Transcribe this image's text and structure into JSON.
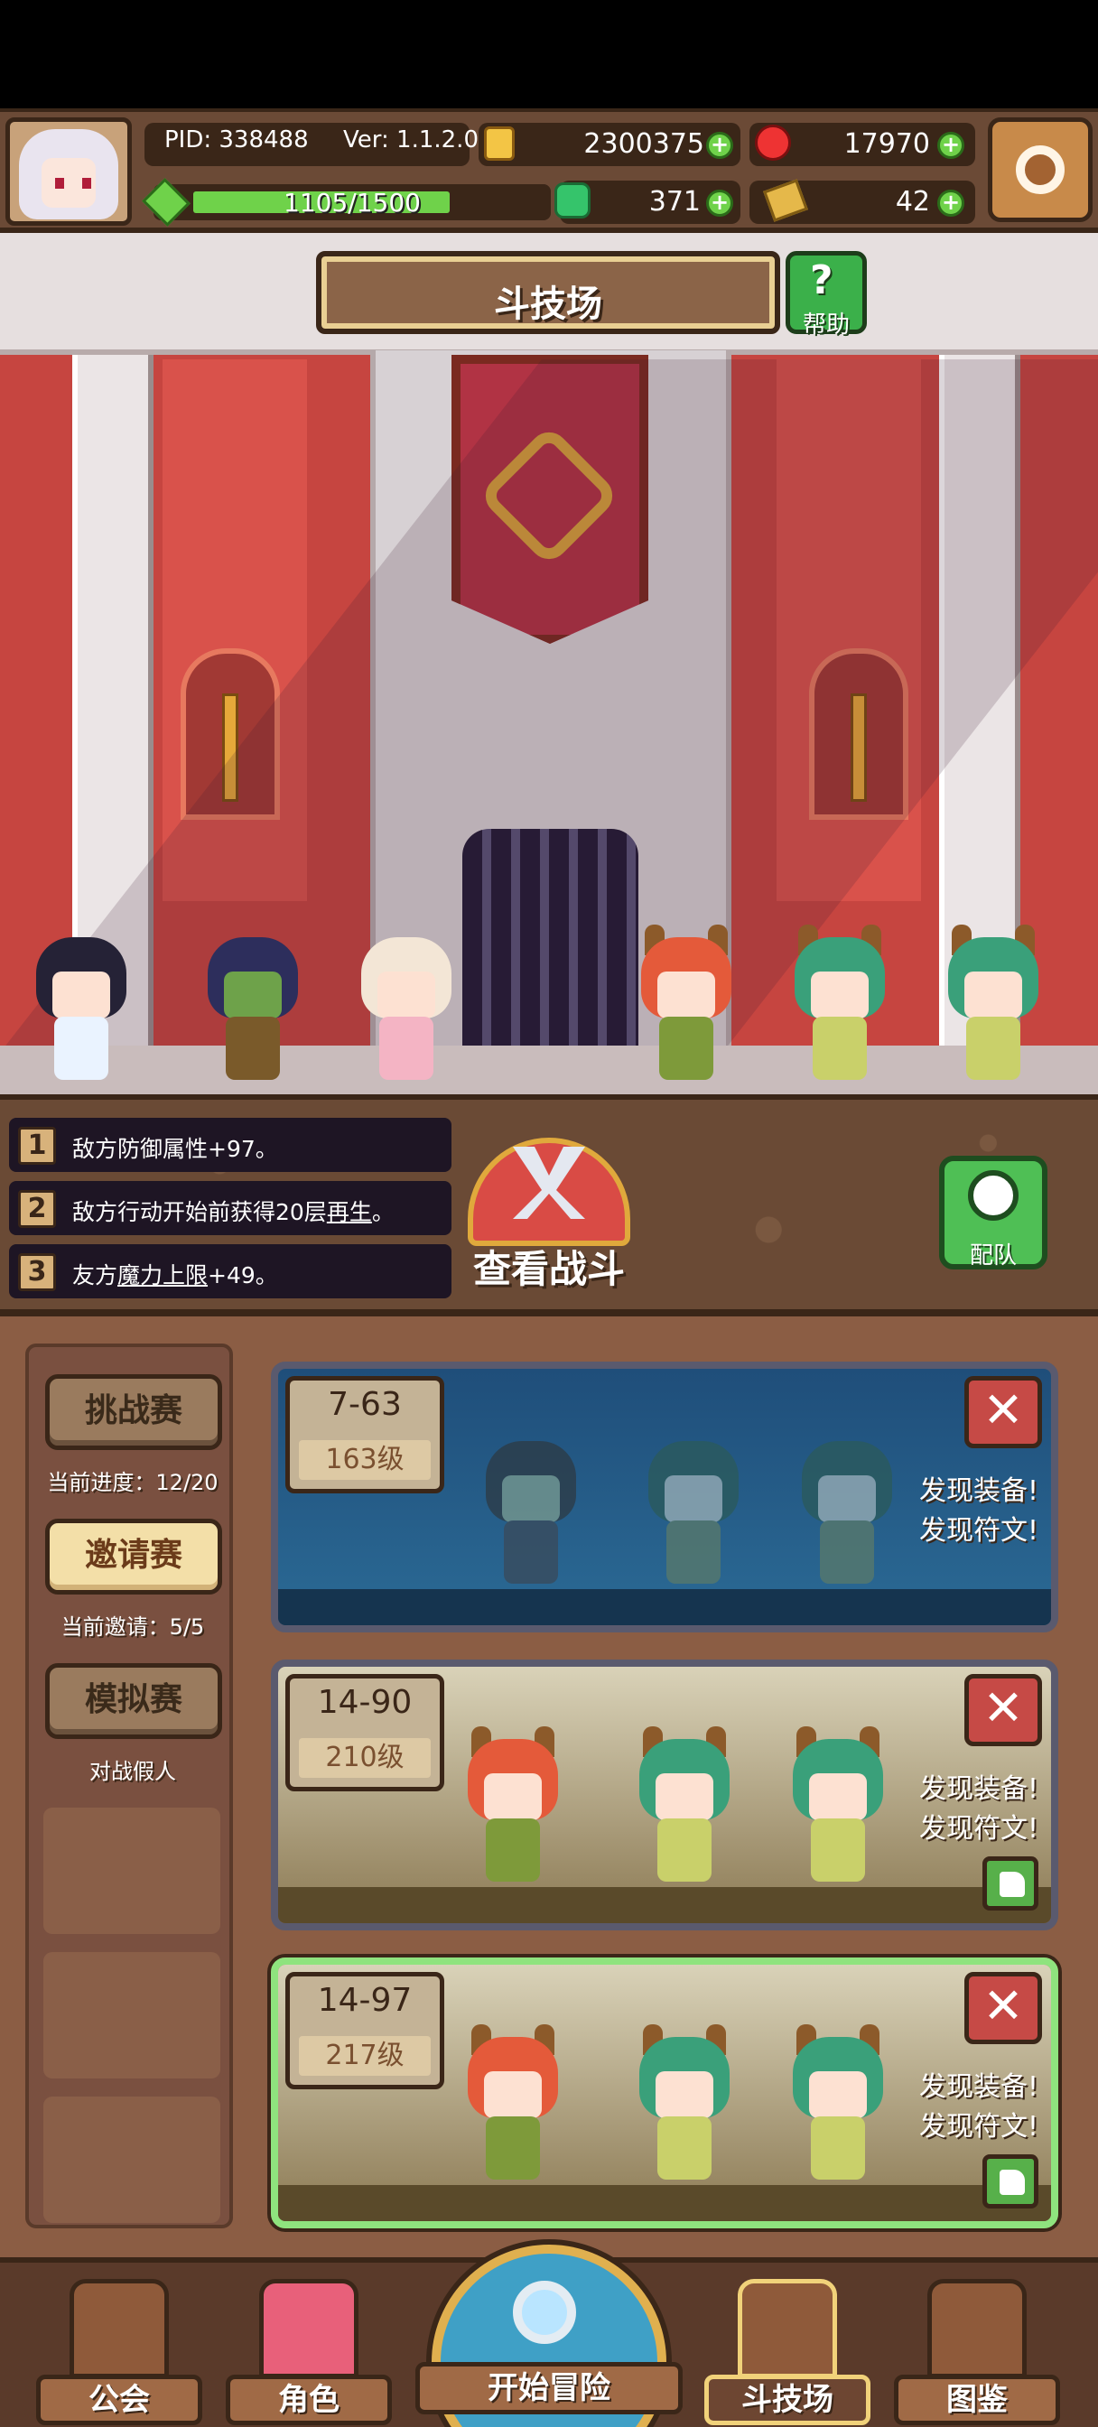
{
  "header": {
    "pid": "PID: 338488",
    "version": "Ver: 1.1.2.0",
    "gold": "2300375",
    "gems": "17970",
    "clover": "371",
    "scrolls": "42",
    "stamina": "1105/1500",
    "stamina_fraction": 0.737
  },
  "title": {
    "label": "斗技场",
    "help_label": "帮助",
    "help_glyph": "?"
  },
  "modifiers": [
    {
      "num": "1",
      "text": "敌方防御属性+97。"
    },
    {
      "num": "2",
      "pre": "敌方行动开始前获得20层",
      "link": "再生",
      "post": "。"
    },
    {
      "num": "3",
      "pre": "友方",
      "link": "魔力上限",
      "post": "+49。"
    }
  ],
  "actions": {
    "watch_battle": "查看战斗",
    "team": "配队"
  },
  "modes": [
    {
      "label": "挑战赛",
      "sub": "当前进度：12/20"
    },
    {
      "label": "邀请赛",
      "sub": "当前邀请：5/5"
    },
    {
      "label": "模拟赛",
      "sub": "对战假人"
    }
  ],
  "opponents": [
    {
      "stage": "7-63",
      "level": "163级",
      "loot1": "发现装备!",
      "loot2": "发现符文!"
    },
    {
      "stage": "14-90",
      "level": "210级",
      "loot1": "发现装备!",
      "loot2": "发现符文!"
    },
    {
      "stage": "14-97",
      "level": "217级",
      "loot1": "发现装备!",
      "loot2": "发现符文!"
    }
  ],
  "close_glyph": "✕",
  "nav": {
    "guild": "公会",
    "character": "角色",
    "adventure": "开始冒险",
    "arena": "斗技场",
    "codex": "图鉴"
  },
  "colors": {
    "accent_green": "#6fd24a",
    "wood": "#8b5d44",
    "arena_red": "#c64540",
    "selected_border": "#8fe37e"
  }
}
